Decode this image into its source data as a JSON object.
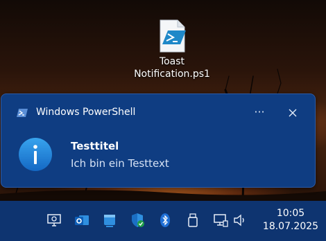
{
  "desktop": {
    "file_icon": {
      "name": "Toast\nNotification.ps1",
      "icon": "powershell-script-icon"
    }
  },
  "notification": {
    "app_name": "Windows PowerShell",
    "app_icon": "powershell-icon",
    "more_label": "···",
    "close_icon": "close-icon",
    "title": "Testtitel",
    "message": "Ich bin ein Testtext",
    "info_icon": "info-icon",
    "accent_color": "#0f3d82"
  },
  "taskbar": {
    "tray_icons": [
      "monitor-settings-icon",
      "outlook-icon",
      "window-app-icon",
      "windows-security-icon",
      "bluetooth-icon",
      "usb-drive-icon",
      "network-icon",
      "speaker-icon"
    ],
    "time": "10:05",
    "date": "18.07.2025"
  }
}
